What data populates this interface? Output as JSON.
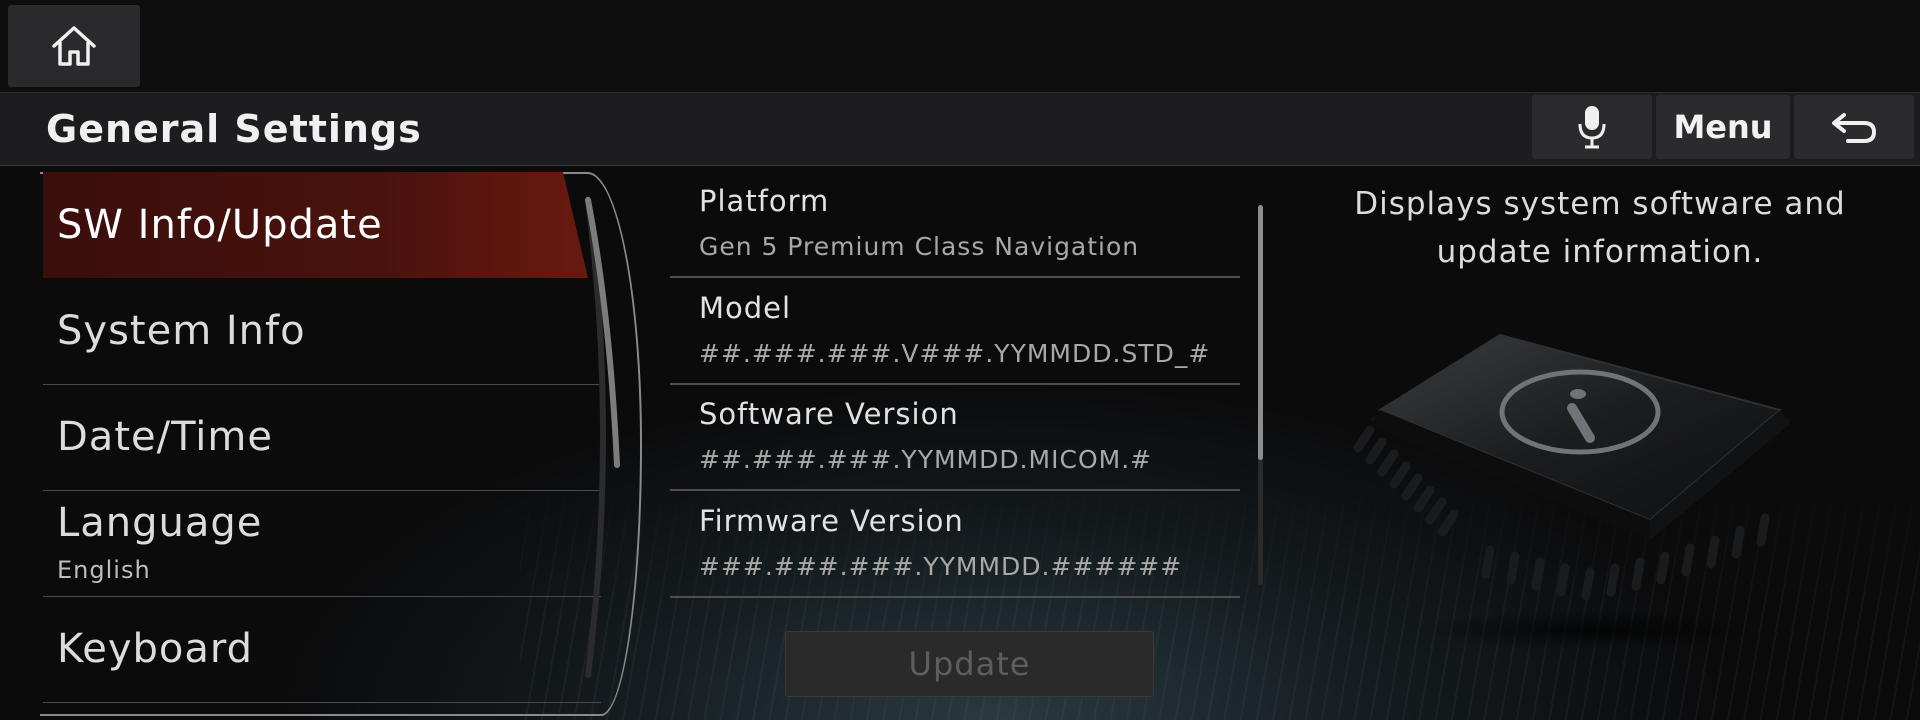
{
  "header": {
    "title": "General Settings",
    "menu_label": "Menu"
  },
  "sidebar": {
    "items": [
      {
        "label": "SW Info/Update",
        "active": true
      },
      {
        "label": "System Info"
      },
      {
        "label": "Date/Time"
      },
      {
        "label": "Language",
        "sub": "English"
      },
      {
        "label": "Keyboard"
      }
    ]
  },
  "info": {
    "rows": [
      {
        "key": "Platform",
        "value": "Gen 5 Premium Class Navigation"
      },
      {
        "key": "Model",
        "value": "##.###.###.V###.YYMMDD.STD_#"
      },
      {
        "key": "Software Version",
        "value": "##.###.###.YYMMDD.MICOM.#"
      },
      {
        "key": "Firmware Version",
        "value": "###.###.###.YYMMDD.######"
      }
    ],
    "update_label": "Update"
  },
  "description": {
    "text": "Displays system software and update information."
  },
  "icons": {
    "home": "home-icon",
    "mic": "microphone-icon",
    "back": "back-arrow-icon",
    "chip": "info-chip-icon"
  },
  "colors": {
    "accent": "#ff5a22",
    "active_bg": "#4a120d"
  }
}
